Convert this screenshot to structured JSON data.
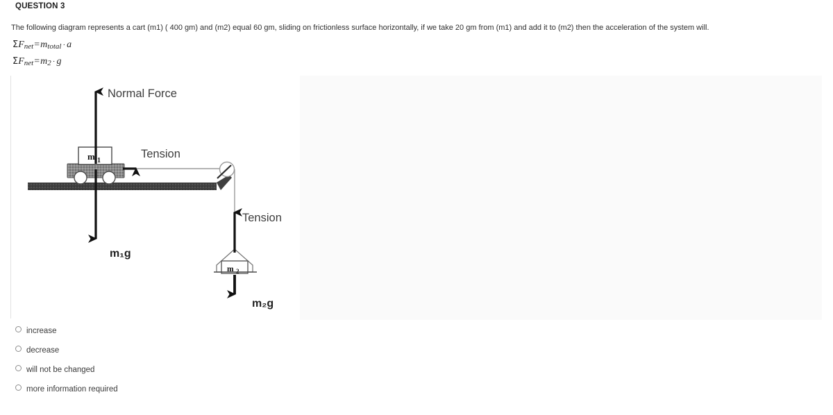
{
  "question": {
    "header": "QUESTION 3",
    "stem": "The following diagram represents a cart (m1) ( 400 gm) and (m2) equal 60 gm,  sliding on frictionless surface horizontally, if we take  20 gm from (m1) and add it to (m2) then the acceleration of the system will.",
    "formulas": [
      {
        "sigma": "Σ",
        "f": "F",
        "f_sub": "net",
        "eq": "=",
        "rhs": "m",
        "rhs_sub": "total",
        "dot": "·",
        "tail": "a"
      },
      {
        "sigma": "Σ",
        "f": "F",
        "f_sub": "net",
        "eq": "=",
        "rhs": "m",
        "rhs_sub": "2",
        "dot": "·",
        "tail": "g"
      }
    ]
  },
  "diagram": {
    "labels": {
      "normal_force": "Normal Force",
      "tension_horizontal": "Tension",
      "tension_vertical": "Tension",
      "weight_cart": "m₁g",
      "weight_hanging": "m₂g",
      "mass_cart": "m",
      "mass_cart_sub": "1",
      "mass_hanging": "m",
      "mass_hanging_sub": "2"
    },
    "colors": {
      "arrow": "#111111",
      "surface": "#3f3f3f",
      "cart_body": "#8a8a8a",
      "wheel": "#ffffff",
      "string": "#9a9a9a",
      "plate": "#fafafa",
      "label_text": "#3d3d3d"
    }
  },
  "options": [
    {
      "label": "increase",
      "selected": false
    },
    {
      "label": "decrease",
      "selected": false
    },
    {
      "label": "will not be changed",
      "selected": false
    },
    {
      "label": "more information required",
      "selected": false
    }
  ]
}
